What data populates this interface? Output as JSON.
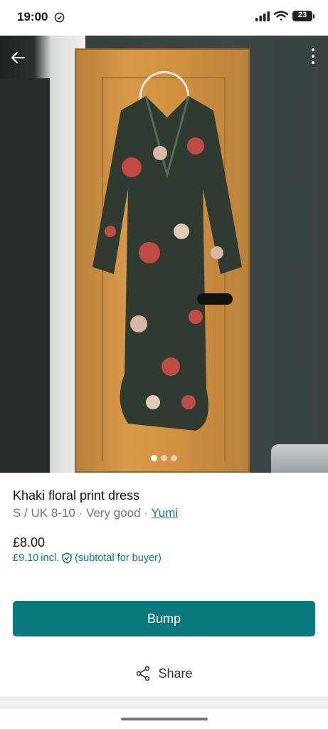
{
  "status_bar": {
    "time": "19:00",
    "battery": "23",
    "icons": [
      "do-not-disturb-icon",
      "signal-icon",
      "wifi-icon",
      "battery-icon"
    ]
  },
  "photo": {
    "current_index": 1,
    "total": 3,
    "icons": [
      "back-arrow-icon",
      "more-vert-icon"
    ]
  },
  "item": {
    "title": "Khaki floral print dress",
    "size": "S / UK 8-10",
    "sep1": " · ",
    "condition": "Very good",
    "sep2": " · ",
    "brand": "Yumi",
    "price": "£8.00",
    "incl_price": "£9.10",
    "incl_label": "incl.",
    "incl_note": "(subtotal for buyer)"
  },
  "actions": {
    "bump_label": "Bump",
    "share_label": "Share"
  },
  "colors": {
    "accent": "#09797e",
    "text_secondary": "#757575"
  }
}
